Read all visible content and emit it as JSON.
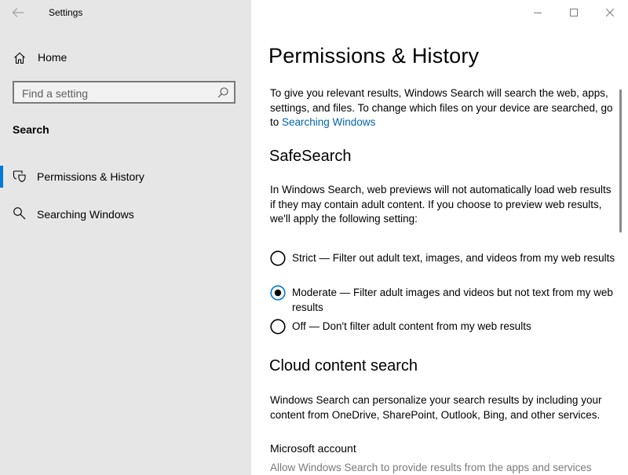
{
  "window": {
    "app_title": "Settings"
  },
  "sidebar": {
    "home_label": "Home",
    "search_placeholder": "Find a setting",
    "section_title": "Search",
    "items": [
      {
        "label": "Permissions & History",
        "selected": true,
        "icon": "shield-search-icon"
      },
      {
        "label": "Searching Windows",
        "selected": false,
        "icon": "search-icon"
      }
    ]
  },
  "main": {
    "title": "Permissions & History",
    "intro_text": "To give you relevant results, Windows Search will search the web, apps, settings, and files. To change which files on your device are searched, go to ",
    "intro_link": "Searching Windows",
    "safesearch": {
      "heading": "SafeSearch",
      "description": "In Windows Search, web previews will not automatically load web results if they may contain adult content. If you choose to preview web results, we'll apply the following setting:",
      "options": [
        {
          "label": "Strict — Filter out adult text, images, and videos from my web results",
          "selected": false
        },
        {
          "label": "Moderate — Filter adult images and videos but not text from my web results",
          "selected": true
        },
        {
          "label": "Off — Don't filter adult content from my web results",
          "selected": false
        }
      ]
    },
    "cloud": {
      "heading": "Cloud content search",
      "description": "Windows Search can personalize your search results by including your content from OneDrive, SharePoint, Outlook, Bing, and other services.",
      "account_heading": "Microsoft account",
      "account_description": "Allow Windows Search to provide results from the apps and services"
    }
  },
  "colors": {
    "accent": "#0078d7",
    "link": "#0063b1",
    "sidebar_bg": "#e6e6e6"
  }
}
